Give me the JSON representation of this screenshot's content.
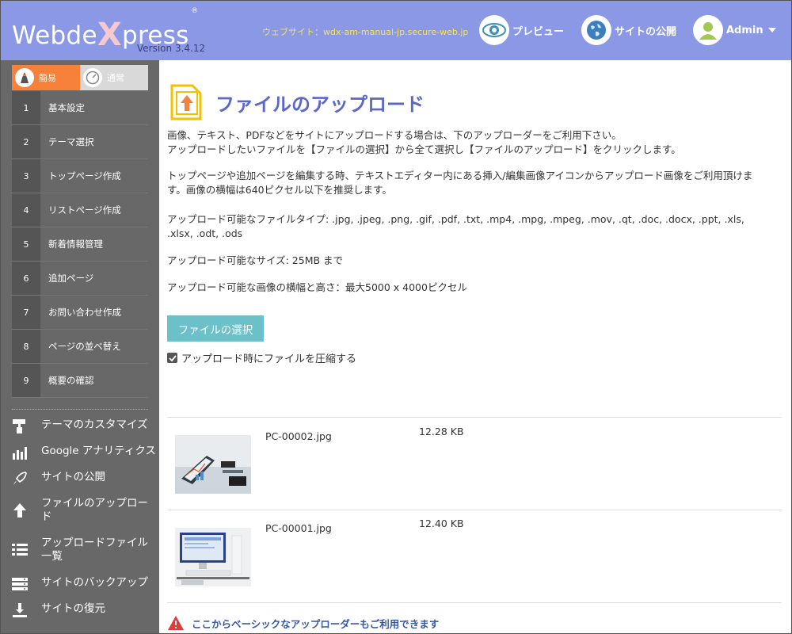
{
  "app": {
    "logo_left": "Webde",
    "logo_x": "X",
    "logo_right": "press",
    "logo_reg": "®",
    "version": "Version 3.4.12"
  },
  "header": {
    "site_url": "ウェブサイト：wdx-am-manual-jp.secure-web.jp",
    "preview_label": "プレビュー",
    "publish_label": "サイトの公開",
    "admin_label": "Admin"
  },
  "sidebar": {
    "mode_easy": "簡易",
    "mode_normal": "通常",
    "steps": [
      {
        "num": "1",
        "label": "基本設定"
      },
      {
        "num": "2",
        "label": "テーマ選択"
      },
      {
        "num": "3",
        "label": "トップページ作成"
      },
      {
        "num": "4",
        "label": "リストページ作成"
      },
      {
        "num": "5",
        "label": "新着情報管理"
      },
      {
        "num": "6",
        "label": "追加ページ"
      },
      {
        "num": "7",
        "label": "お問い合わせ作成"
      },
      {
        "num": "8",
        "label": "ページの並べ替え"
      },
      {
        "num": "9",
        "label": "概要の確認"
      }
    ],
    "tools": [
      {
        "label": "テーマのカスタマイズ",
        "icon": "paint-roller-icon"
      },
      {
        "label": "Google アナリティクス",
        "icon": "bar-chart-icon"
      },
      {
        "label": "サイトの公開",
        "icon": "rocket-icon"
      },
      {
        "label_line1": "ファイルのアップロー",
        "label_line2": "ド",
        "icon": "upload-arrow-icon"
      },
      {
        "label_line1": "アップロードファイル",
        "label_line2": "一覧",
        "icon": "list-icon"
      },
      {
        "label": "サイトのバックアップ",
        "icon": "server-icon"
      },
      {
        "label": "サイトの復元",
        "icon": "download-icon"
      }
    ]
  },
  "main": {
    "title": "ファイルのアップロード",
    "p1_line1": "画像、テキスト、PDFなどをサイトにアップロードする場合は、下のアップローダーをご利用下さい。",
    "p1_line2": "アップロードしたいファイルを【ファイルの選択】から全て選択し【ファイルのアップロード】をクリックします。",
    "p2_line1": "トップページや追加ページを編集する時、テキストエディター内にある挿入/編集画像アイコンからアップロード画像をご利用頂けま",
    "p2_line2": "す。画像の横幅は640ピクセル以下を推奨します。",
    "p3_line1": "アップロード可能なファイルタイプ: .jpg, .jpeg, .png, .gif, .pdf, .txt, .mp4, .mpg, .mpeg, .mov, .qt, .doc, .docx, .ppt, .xls,",
    "p3_line2": ".xlsx, .odt, .ods",
    "p4": "アップロード可能なサイズ: 25MB まで",
    "p5": "アップロード可能な画像の横幅と高さ：最大5000 x 4000ピクセル",
    "select_button": "ファイルの選択",
    "compress_label": "アップロード時にファイルを圧縮する",
    "compress_checked": true,
    "files": [
      {
        "name": "PC-00002.jpg",
        "size": "12.28 KB"
      },
      {
        "name": "PC-00001.jpg",
        "size": "12.40 KB"
      }
    ],
    "basic_uploader_link": "ここからベーシックなアップローダーもご利用できます"
  },
  "colors": {
    "header_bg": "#8a98e6",
    "sidebar_bg": "#686868",
    "accent_orange": "#f7813b",
    "title_blue": "#5b67c9",
    "button_teal": "#6cc1c9",
    "url_yellow": "#f7e44a"
  }
}
